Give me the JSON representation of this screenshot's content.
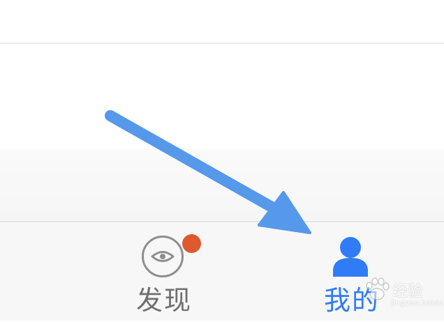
{
  "tabbar": {
    "tabs": [
      {
        "label": "发现",
        "icon": "eye-icon",
        "color": "#6f6f6f",
        "has_badge": true,
        "badge_color": "#dd5a2d",
        "active": false
      },
      {
        "label": "我的",
        "icon": "person-icon",
        "color": "#2f7cf6",
        "active": true
      }
    ]
  },
  "annotation": {
    "arrow_color": "#5698ea",
    "target": "tab-me"
  },
  "watermark": {
    "text": "经验",
    "url": "jingyan.baidu.com"
  }
}
